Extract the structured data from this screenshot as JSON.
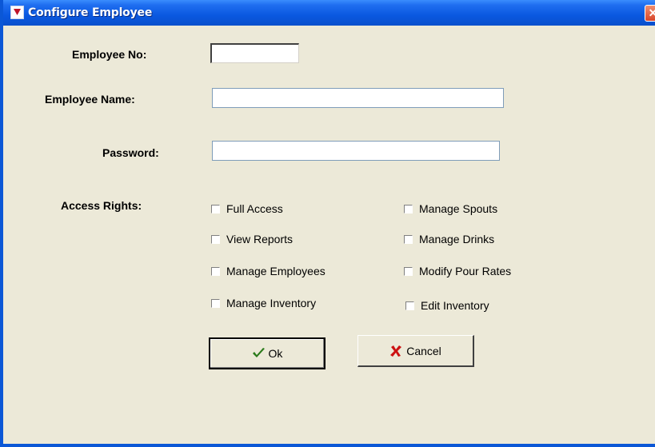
{
  "window": {
    "title": "Configure Employee",
    "close_label": "✕"
  },
  "form": {
    "employee_no_label": "Employee No:",
    "employee_no_value": "",
    "employee_name_label": "Employee Name:",
    "employee_name_value": "",
    "password_label": "Password:",
    "password_value": "",
    "access_rights_label": "Access Rights:"
  },
  "access_rights": [
    {
      "label": "Full Access",
      "checked": false
    },
    {
      "label": "View Reports",
      "checked": false
    },
    {
      "label": "Manage Employees",
      "checked": false
    },
    {
      "label": "Manage Inventory",
      "checked": false
    },
    {
      "label": "Manage Spouts",
      "checked": false
    },
    {
      "label": "Manage Drinks",
      "checked": false
    },
    {
      "label": "Modify Pour Rates",
      "checked": false
    },
    {
      "label": "Edit Inventory",
      "checked": false
    }
  ],
  "buttons": {
    "ok_label": "Ok",
    "cancel_label": "Cancel"
  },
  "colors": {
    "titlebar": "#0a58e0",
    "check_icon": "#2a7a1a",
    "cancel_icon": "#cc1111"
  }
}
